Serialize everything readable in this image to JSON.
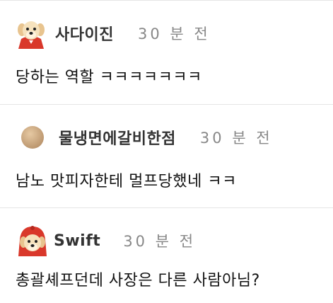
{
  "comments": [
    {
      "nickname": "사다이진",
      "time": "30 분 전",
      "text": "당하는 역할 ㅋㅋㅋㅋㅋㅋㅋ",
      "avatar_icon": "puppy-red-cape-icon"
    },
    {
      "nickname": "물냉면에갈비한점",
      "time": "30 분 전",
      "text": "남노 맛피자한테 멀프당했네 ㅋㅋ",
      "avatar_icon": "beige-circle-icon"
    },
    {
      "nickname": "Swift",
      "time": "30 분 전",
      "text": "총괄셰프던데 사장은 다른 사람아님?",
      "avatar_icon": "puppy-red-hood-icon"
    }
  ],
  "colors": {
    "nickname": "#333333",
    "time": "#888888",
    "divider": "#e5e5e5",
    "cape_red": "#d9382b"
  }
}
